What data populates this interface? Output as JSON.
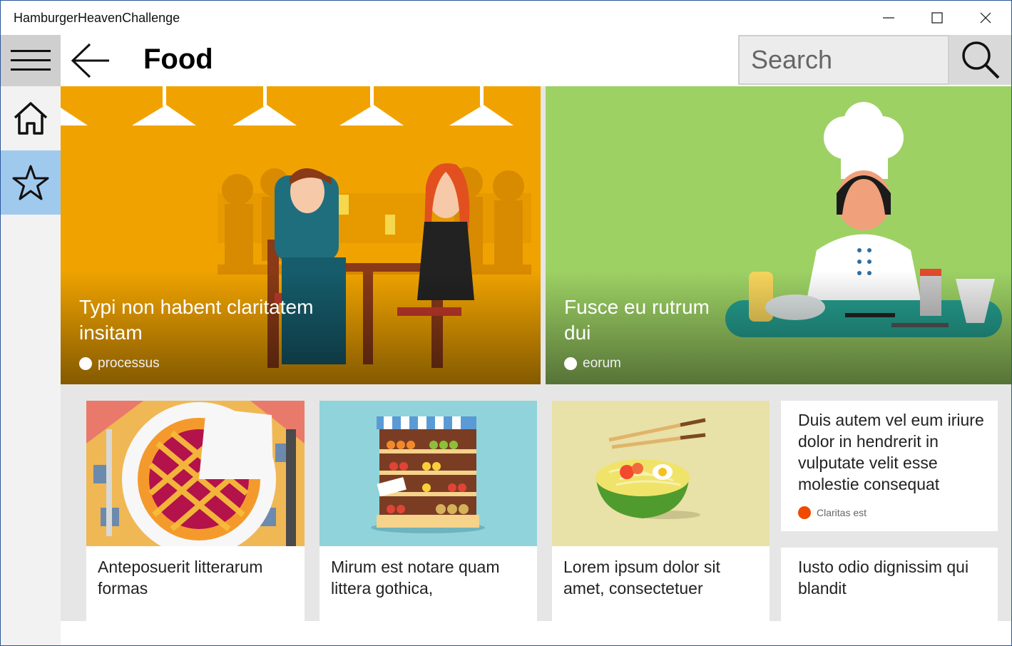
{
  "window": {
    "title": "HamburgerHeavenChallenge"
  },
  "header": {
    "title": "Food",
    "search_placeholder": "Search"
  },
  "sidebar": {
    "items": [
      {
        "icon": "home-icon"
      },
      {
        "icon": "star-icon"
      }
    ]
  },
  "colors": {
    "accent": "#a0c9ee",
    "hero1": "#f0a300",
    "hero2": "#9dd164",
    "alert_dot": "#f04a00"
  },
  "heroes": [
    {
      "title": "Typi non habent claritatem insitam",
      "meta": "processus"
    },
    {
      "title": "Fusce eu rutrum dui",
      "meta": "eorum"
    }
  ],
  "cards": [
    {
      "title": "Anteposuerit litterarum formas"
    },
    {
      "title": "Mirum est notare quam littera gothica,"
    },
    {
      "title": "Lorem ipsum dolor sit amet, consectetuer"
    }
  ],
  "textcards": [
    {
      "title": "Duis autem vel eum iriure dolor in hendrerit in vulputate velit esse molestie consequat",
      "meta": "Claritas est"
    },
    {
      "title": "Iusto odio dignissim qui blandit"
    }
  ]
}
